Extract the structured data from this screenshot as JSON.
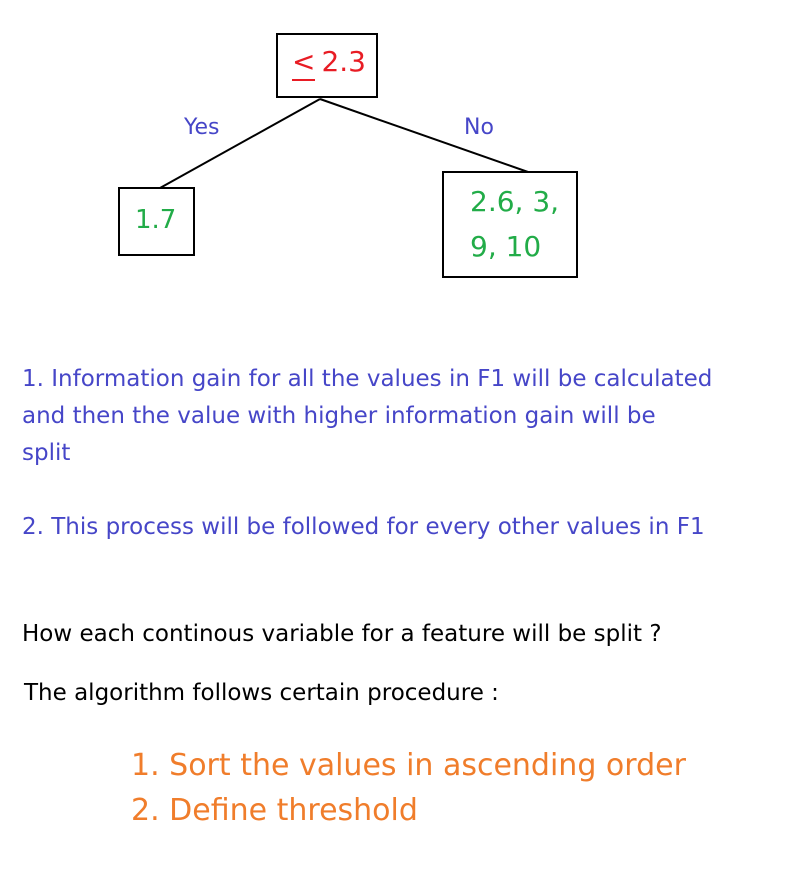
{
  "tree": {
    "root": {
      "symbol": "<",
      "value": "2.3"
    },
    "edge_yes": "Yes",
    "edge_no": "No",
    "left_leaf": "1.7",
    "right_leaf_line1": "2.6, 3,",
    "right_leaf_line2": "9, 10"
  },
  "notes": {
    "point1_line1": "1. Information gain for all the values in F1 will be calculated",
    "point1_line2": "and then the value with higher information gain will be",
    "point1_line3": "split",
    "point2": "2. This process will be followed for every other values in F1"
  },
  "question": "How each continous variable for a feature will be split ?",
  "procedure_intro": "The algorithm follows certain procedure :",
  "steps": [
    "1. Sort the values in ascending order",
    "2. Define threshold"
  ],
  "colors": {
    "edge_text": "#4646c8",
    "leaf_text": "#22ac48",
    "root_text": "#e81c24",
    "steps_text": "#f07d2b"
  }
}
